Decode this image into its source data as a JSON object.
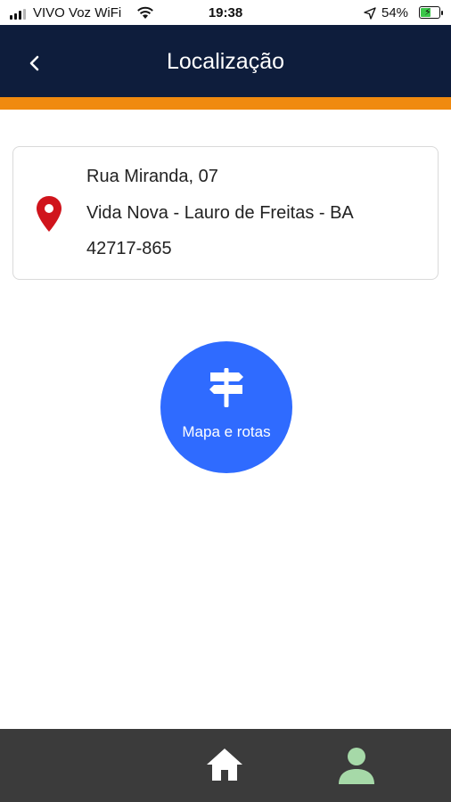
{
  "status_bar": {
    "carrier": "VIVO Voz WiFi",
    "time": "19:38",
    "battery_percent": "54%",
    "battery_level": 0.54,
    "icons": [
      "signal-icon",
      "wifi-icon",
      "location-arrow-icon",
      "battery-charging-icon"
    ]
  },
  "header": {
    "title": "Localização",
    "back_icon": "chevron-left-icon",
    "background_color": "#0e1d3c",
    "accent_color": "#f08a0f"
  },
  "address": {
    "icon": "map-pin-icon",
    "icon_color": "#d0141c",
    "line1": "Rua Miranda, 07",
    "line2": "Vida Nova - Lauro de Freitas - BA",
    "line3": "42717-865"
  },
  "map_button": {
    "label": "Mapa e rotas",
    "icon": "signpost-icon",
    "color": "#2f6bff"
  },
  "bottom_nav": {
    "items": [
      {
        "name": "home",
        "icon": "home-icon",
        "color": "#ffffff"
      },
      {
        "name": "profile",
        "icon": "user-icon",
        "color": "#a6d9a8"
      }
    ]
  }
}
